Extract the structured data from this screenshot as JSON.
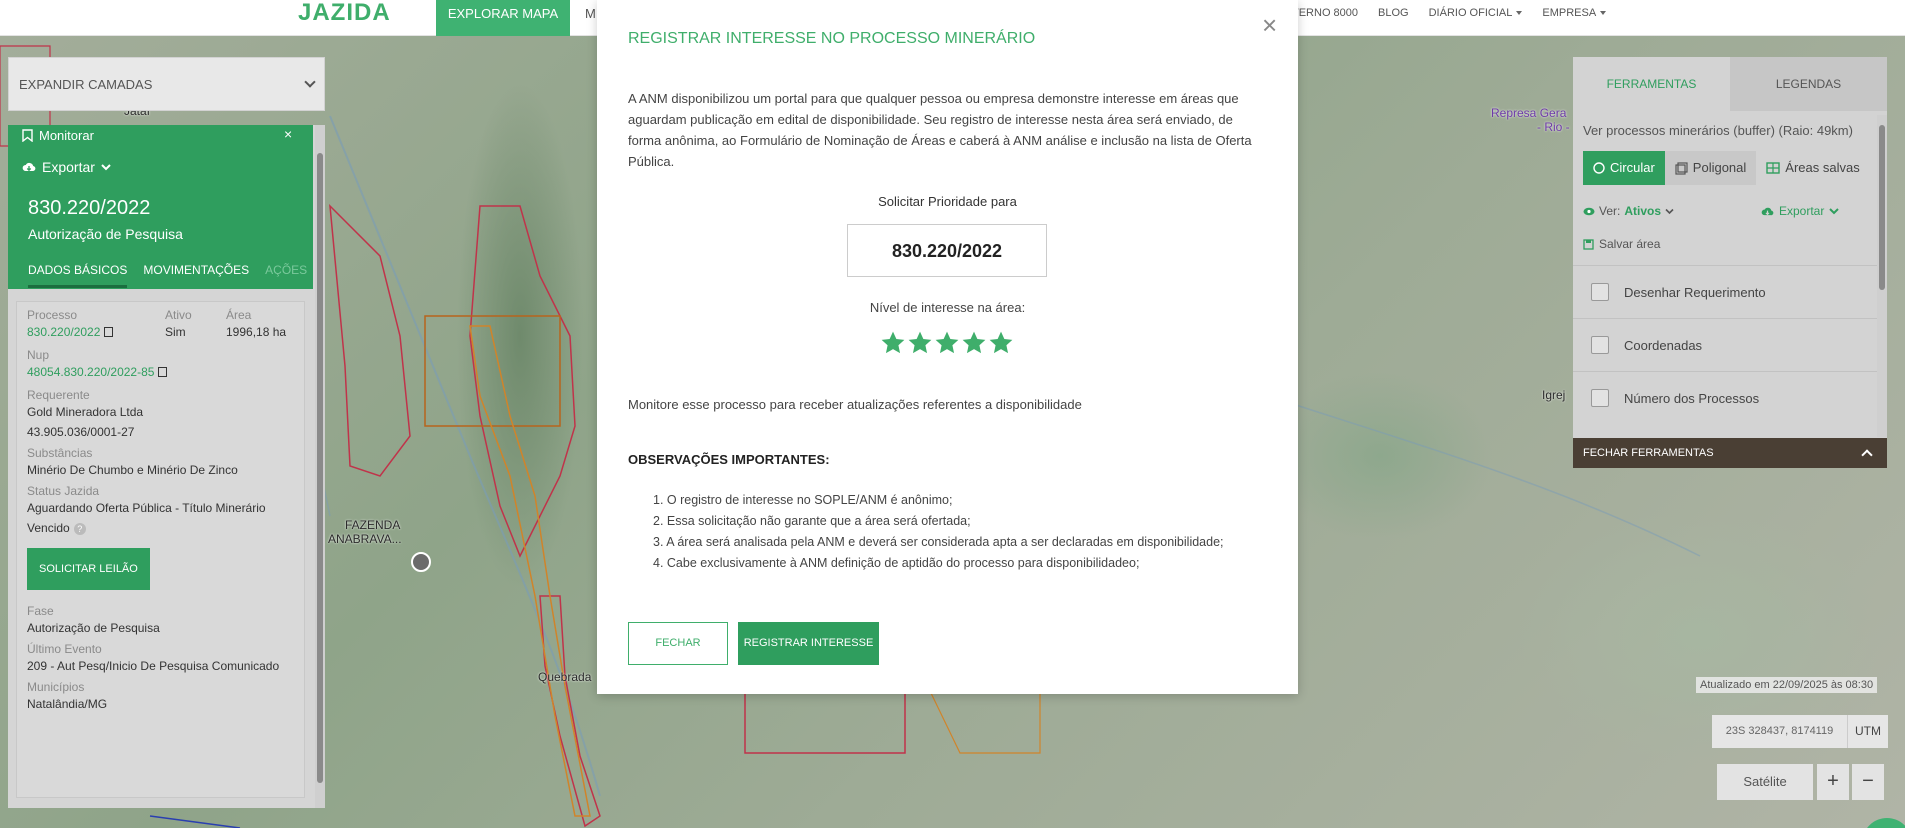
{
  "topbar": {
    "logo": "JAZIDA",
    "nav_active": "EXPLORAR MAPA",
    "nav_truncated": "M",
    "nav_items": [
      {
        "label": "TERNO 8000",
        "dropdown": false
      },
      {
        "label": "BLOG",
        "dropdown": false
      },
      {
        "label": "DIÁRIO OFICIAL",
        "dropdown": true
      },
      {
        "label": "EMPRESA",
        "dropdown": true
      }
    ]
  },
  "map": {
    "labels": [
      "Jataí",
      "FAZENDA",
      "ANABRAVA...",
      "Quebrada",
      "Represa Gera",
      "- Rio -",
      "Igrej"
    ]
  },
  "layers": {
    "expand_label": "EXPANDIR CAMADAS"
  },
  "process_panel": {
    "monitor_label": "Monitorar",
    "export_label": "Exportar",
    "code": "830.220/2022",
    "type": "Autorização de Pesquisa",
    "tabs": [
      "DADOS BÁSICOS",
      "MOVIMENTAÇÕES",
      "AÇÕES"
    ],
    "fields": {
      "processo_label": "Processo",
      "processo_value": "830.220/2022",
      "ativo_label": "Ativo",
      "ativo_value": "Sim",
      "area_label": "Área",
      "area_value": "1996,18 ha",
      "nup_label": "Nup",
      "nup_value": "48054.830.220/2022-85",
      "requerente_label": "Requerente",
      "requerente_name": "Gold Mineradora Ltda",
      "requerente_cnpj": "43.905.036/0001-27",
      "substancias_label": "Substâncias",
      "substancias_value": "Minério De Chumbo e Minério De Zinco",
      "status_label": "Status Jazida",
      "status_value": "Aguardando Oferta Pública - Título Minerário",
      "status_value_2": "Vencido",
      "solicitar_btn": "SOLICITAR LEILÃO",
      "fase_label": "Fase",
      "fase_value": "Autorização de Pesquisa",
      "evento_label": "Último Evento",
      "evento_value": "209 - Aut Pesq/Inicio De Pesquisa Comunicado",
      "municipios_label": "Municípios",
      "municipios_value": "Natalândia/MG"
    }
  },
  "modal": {
    "title": "REGISTRAR INTERESSE NO PROCESSO MINERÁRIO",
    "description": "A ANM disponibilizou um portal para que qualquer pessoa ou empresa demonstre interesse em áreas que aguardam publicação em edital de disponibilidade. Seu registro de interesse nesta área será enviado, de forma anônima, ao Formulário de Nominação de Áreas e caberá à ANM análise e inclusão na lista de Oferta Pública.",
    "priority_label": "Solicitar Prioridade para",
    "priority_value": "830.220/2022",
    "interest_label": "Nível de interesse na área:",
    "interest_rating": 5,
    "interest_max": 5,
    "monitor_text": "Monitore esse processo para receber atualizações referentes a disponibilidade",
    "obs_title": "OBSERVAÇÕES IMPORTANTES:",
    "obs_items": [
      "1. O registro de interesse no SOPLE/ANM é anônimo;",
      "2. Essa solicitação não garante que a área será ofertada;",
      "3. A área será analisada pela ANM e deverá ser considerada apta a ser declaradas em disponibilidade;",
      "4. Cabe exclusivamente à ANM definição de aptidão do processo para disponibilidadeo;"
    ],
    "close_btn": "FECHAR",
    "register_btn": "REGISTRAR INTERESSE"
  },
  "tools_panel": {
    "tabs": [
      "FERRAMENTAS",
      "LEGENDAS"
    ],
    "buffer_text": "Ver processos minerários (buffer) (Raio: 49km)",
    "modes": [
      "Circular",
      "Poligonal",
      "Áreas salvas"
    ],
    "ver_label": "Ver:",
    "ver_value": "Ativos",
    "export_label": "Exportar",
    "save_label": "Salvar área",
    "options": [
      "Desenhar Requerimento",
      "Coordenadas",
      "Número dos Processos"
    ],
    "footer": "FECHAR FERRAMENTAS"
  },
  "map_controls": {
    "updated": "Atualizado em 22/09/2025 às 08:30",
    "coords": "23S 328437, 8174119",
    "coord_system": "UTM",
    "satellite_btn": "Satélite",
    "zoom_in": "+",
    "zoom_out": "−"
  },
  "colors": {
    "brand_green": "#2f9e5e",
    "accent_green": "#3fae6b",
    "tools_footer": "#4a3f34"
  }
}
